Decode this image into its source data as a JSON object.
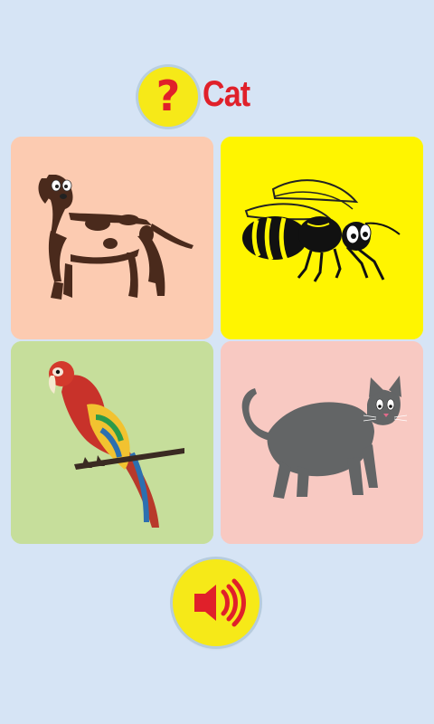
{
  "question": {
    "icon": "question-mark-icon",
    "glyph": "?",
    "target_word": "Cat"
  },
  "cards": [
    {
      "animal": "dog",
      "color": "#fccbb1"
    },
    {
      "animal": "bee",
      "color": "#fff500"
    },
    {
      "animal": "parrot",
      "color": "#c6de9b"
    },
    {
      "animal": "cat",
      "color": "#f8c9c2"
    }
  ],
  "speaker": {
    "icon": "speaker-icon"
  },
  "colors": {
    "background": "#d6e4f5",
    "accent_red": "#e0202a",
    "button_yellow": "#f6e918"
  }
}
